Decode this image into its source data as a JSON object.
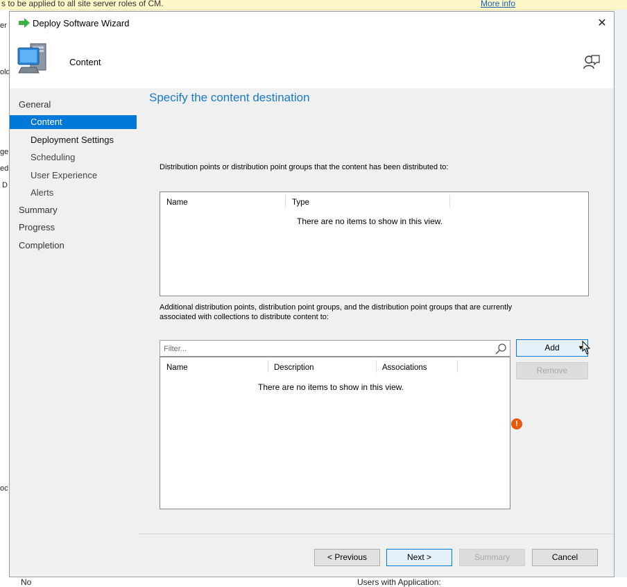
{
  "background_app": {
    "banner_text": "s to be applied to all site server roles of CM.",
    "banner_link": "More info",
    "left_fragments": [
      "er",
      "old",
      "ge",
      "ed",
      "D",
      "oc"
    ],
    "bottom_left": "No",
    "bottom_mid": "Users with Application:"
  },
  "dialog": {
    "title": "Deploy Software Wizard",
    "close_glyph": "✕",
    "header_title": "Content"
  },
  "nav": {
    "items": [
      {
        "label": "General",
        "level": 0,
        "selected": false
      },
      {
        "label": "Content",
        "level": 1,
        "selected": true
      },
      {
        "label": "Deployment Settings",
        "level": 1,
        "selected": false
      },
      {
        "label": "Scheduling",
        "level": 1,
        "selected": false
      },
      {
        "label": "User Experience",
        "level": 1,
        "selected": false
      },
      {
        "label": "Alerts",
        "level": 1,
        "selected": false
      },
      {
        "label": "Summary",
        "level": 0,
        "selected": false
      },
      {
        "label": "Progress",
        "level": 0,
        "selected": false
      },
      {
        "label": "Completion",
        "level": 0,
        "selected": false
      }
    ]
  },
  "page": {
    "heading": "Specify the content destination",
    "distributed_label": "Distribution points or distribution point groups that the content has been distributed to:",
    "list1": {
      "columns": [
        "Name",
        "Type"
      ],
      "empty_message": "There are no items to show in this view."
    },
    "additional_label_line1": "Additional distribution points, distribution point groups, and the distribution point groups that are currently",
    "additional_label_line2": "associated with collections to distribute content to:",
    "filter_placeholder": "Filter...",
    "list2": {
      "columns": [
        "Name",
        "Description",
        "Associations"
      ],
      "empty_message": "There are no items to show in this view."
    },
    "add_label": "Add",
    "remove_label": "Remove",
    "warning_glyph": "!"
  },
  "footer": {
    "previous_label": "< Previous",
    "next_label": "Next >",
    "summary_label": "Summary",
    "cancel_label": "Cancel"
  },
  "colors": {
    "accent": "#0078d7",
    "heading": "#1979ca",
    "warning": "#e8590c"
  }
}
